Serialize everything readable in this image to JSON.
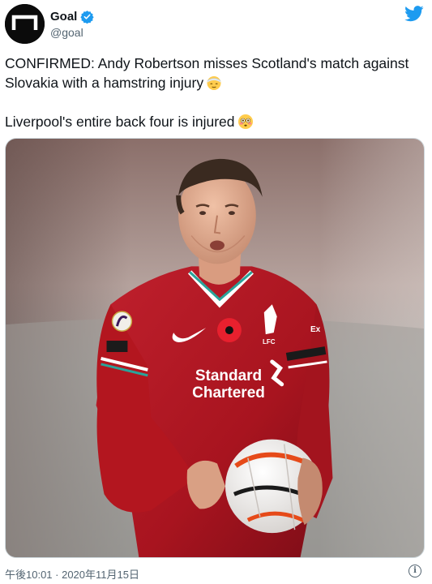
{
  "author": {
    "display_name": "Goal",
    "handle": "@goal",
    "verified": true
  },
  "icons": {
    "avatar": "goal-logo-icon",
    "verified": "verified-badge-icon",
    "brand": "twitter-bird-icon",
    "emoji_1": "face-with-head-bandage-emoji",
    "emoji_2": "flushed-face-emoji",
    "info": "info-icon"
  },
  "tweet": {
    "line1": "CONFIRMED: Andy Robertson misses Scotland's match against Slovakia with a hamstring injury",
    "line2": "Liverpool's entire back four is injured"
  },
  "photo": {
    "sponsor_line1": "Standard",
    "sponsor_line2": "Chartered",
    "crest_text": "LFC",
    "sleeve_patch": "Ex"
  },
  "footer": {
    "timestamp": "午後10:01 · 2020年11月15日",
    "info_glyph": "i"
  },
  "colors": {
    "brand_blue": "#1d9bf0",
    "text_primary": "#0f1419",
    "text_secondary": "#536471"
  }
}
